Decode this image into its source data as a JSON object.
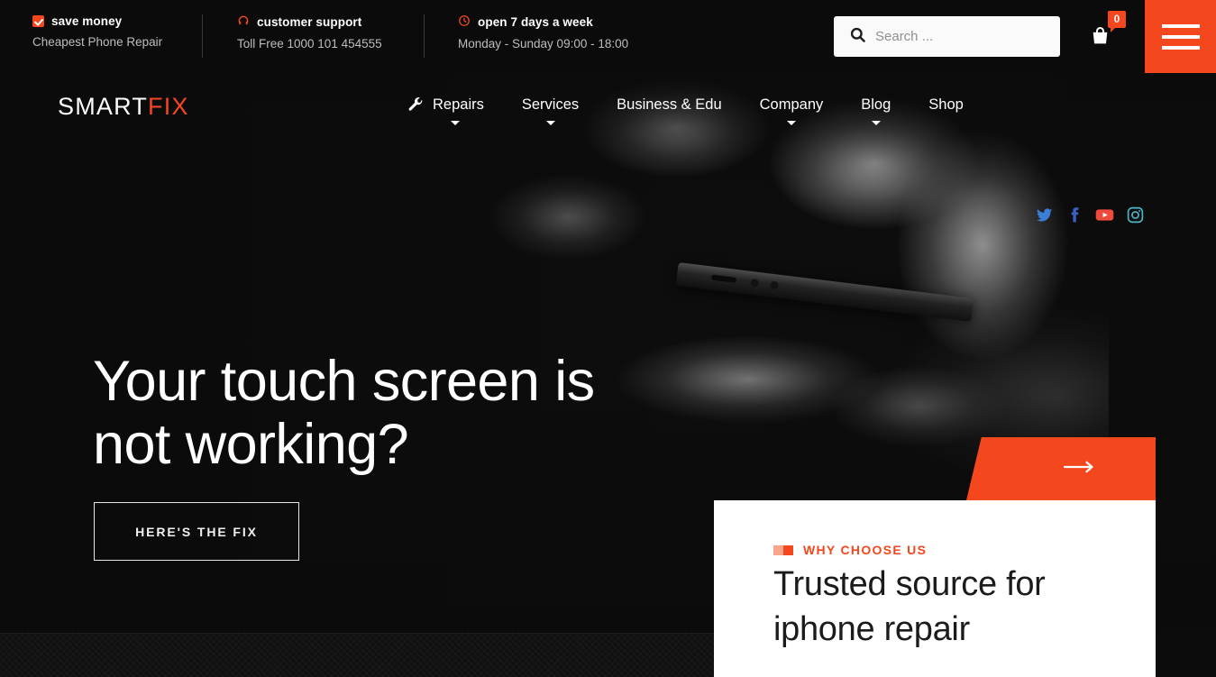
{
  "brand": {
    "name_part1": "SMART",
    "name_part2": "FIX",
    "accent_color": "#f4471e"
  },
  "topbar": {
    "info": [
      {
        "icon": "checkbox-icon",
        "title": "save money",
        "subtitle": "Cheapest Phone Repair"
      },
      {
        "icon": "headset-icon",
        "title": "customer support",
        "subtitle": "Toll Free 1000 101 454555"
      },
      {
        "icon": "clock-icon",
        "title": "open 7 days a week",
        "subtitle": "Monday - Sunday 09:00 - 18:00"
      }
    ],
    "search": {
      "icon": "search-icon",
      "placeholder": "Search ...",
      "value": ""
    },
    "cart": {
      "icon": "shopping-bag-icon",
      "count": "0"
    },
    "menu_toggle": {
      "icon": "hamburger-icon"
    }
  },
  "nav": {
    "items": [
      {
        "label": "Repairs",
        "icon": "wrench-icon",
        "has_dropdown": true
      },
      {
        "label": "Services",
        "icon": "",
        "has_dropdown": true
      },
      {
        "label": "Business & Edu",
        "icon": "",
        "has_dropdown": false
      },
      {
        "label": "Company",
        "icon": "",
        "has_dropdown": true
      },
      {
        "label": "Blog",
        "icon": "",
        "has_dropdown": true
      },
      {
        "label": "Shop",
        "icon": "",
        "has_dropdown": false
      }
    ],
    "socials": [
      {
        "name": "twitter-icon",
        "color": "#3a7fd5"
      },
      {
        "name": "facebook-icon",
        "color": "#3b5fc0"
      },
      {
        "name": "youtube-icon",
        "color": "#ef4b3c"
      },
      {
        "name": "instagram-icon",
        "color": "#4bb8c9"
      }
    ]
  },
  "hero": {
    "title_line1": "Your touch screen is",
    "title_line2": "not working?",
    "cta_label": "HERE'S THE FIX"
  },
  "why_choose": {
    "banner": {
      "icon": "arrow-right-icon"
    },
    "eyebrow": "WHY CHOOSE US",
    "title_line1": "Trusted source for",
    "title_line2": "iphone repair"
  }
}
